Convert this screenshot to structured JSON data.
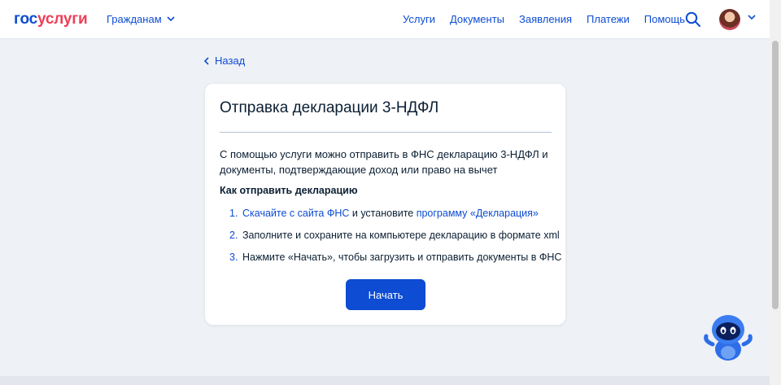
{
  "header": {
    "logo_part1": "гос",
    "logo_part2": "услуги",
    "role": "Гражданам",
    "nav": [
      "Услуги",
      "Документы",
      "Заявления",
      "Платежи",
      "Помощь"
    ]
  },
  "back": "Назад",
  "card": {
    "title": "Отправка декларации 3-НДФЛ",
    "description": "С помощью услуги можно отправить в ФНС декларацию 3-НДФЛ и документы, подтверждающие доход или право на вычет",
    "subtitle": "Как отправить декларацию",
    "steps": [
      {
        "num": "1.",
        "link1": "Скачайте с сайта ФНС",
        "text": " и установите ",
        "link2": "программу «Декларация»"
      },
      {
        "num": "2.",
        "text": "Заполните и сохраните на компьютере декларацию в формате xml"
      },
      {
        "num": "3.",
        "text": "Нажмите «Начать», чтобы загрузить и отправить документы в ФНС"
      }
    ],
    "button": "Начать"
  },
  "colors": {
    "accent": "#0d4cd3",
    "brand_red": "#ee3f58",
    "background": "#eef1f5",
    "text": "#0b1f33"
  },
  "icons": [
    "chevron-down-icon",
    "search-icon",
    "chevron-left-icon",
    "robot-assistant-icon"
  ]
}
